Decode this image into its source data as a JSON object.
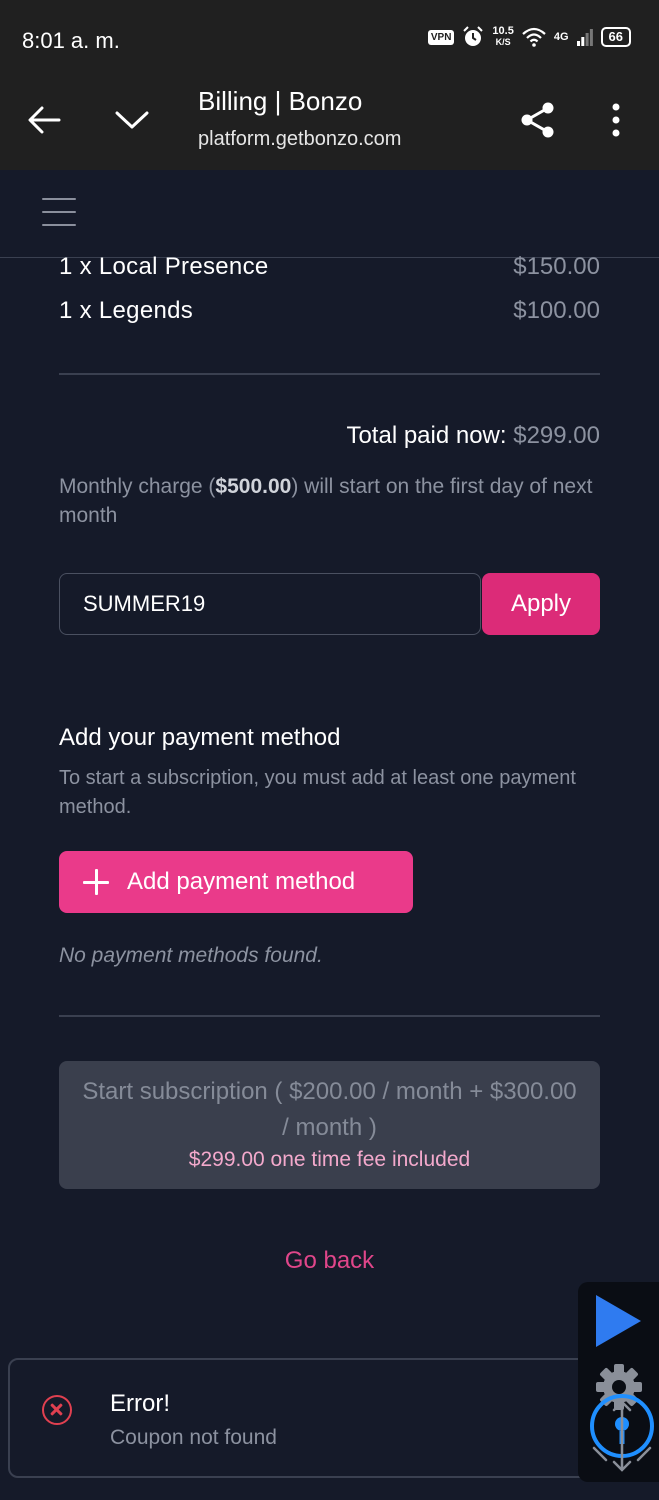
{
  "status_bar": {
    "time": "8:01 a. m.",
    "vpn": "VPN",
    "net_speed_value": "10.5",
    "net_speed_unit": "K/S",
    "network": "4G",
    "battery": "66"
  },
  "browser": {
    "title": "Billing | Bonzo",
    "url": "platform.getbonzo.com"
  },
  "order": {
    "items": [
      {
        "name": "1 x Local Presence",
        "price": "$150.00"
      },
      {
        "name": "1 x Legends",
        "price": "$100.00"
      }
    ],
    "total_label": "Total paid now:",
    "total_value": "$299.00",
    "monthly_prefix": "Monthly charge (",
    "monthly_amount": "$500.00",
    "monthly_suffix": ") will start on the first day of next month"
  },
  "coupon": {
    "value": "SUMMER19",
    "apply_label": "Apply"
  },
  "payment": {
    "heading": "Add your payment method",
    "subtext": "To start a subscription, you must add at least one payment method.",
    "add_label": "Add payment method",
    "empty_text": "No payment methods found."
  },
  "subscription": {
    "button_main": "Start subscription ( $200.00 / month + $300.00 / month )",
    "button_fee": "$299.00 one time fee included"
  },
  "go_back": "Go back",
  "toast": {
    "title": "Error!",
    "message": "Coupon not found"
  },
  "colors": {
    "background": "#151a29",
    "accent_pink": "#ea3a8a",
    "apply_pink": "#dc2b78",
    "error_red": "#e04050",
    "disabled_button": "#3a3f4d"
  },
  "icons": {
    "browser_back": "arrow-left-icon",
    "browser_collapse": "chevron-down-icon",
    "share": "share-icon",
    "more": "more-vertical-icon",
    "menu": "hamburger-menu-icon",
    "add": "plus-icon",
    "error": "error-circle-x-icon",
    "float_play": "play-icon",
    "float_settings": "gear-icon",
    "float_touch": "touch-move-icon"
  }
}
